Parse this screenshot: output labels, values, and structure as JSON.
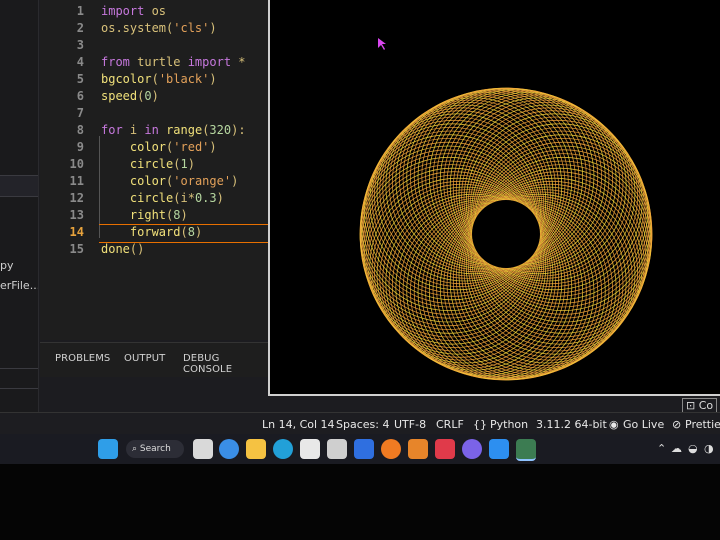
{
  "sidebar": {
    "items": [
      {
        "label": "py"
      },
      {
        "label": "erFile...."
      }
    ]
  },
  "editor": {
    "active_line": 14,
    "lines": [
      {
        "num": "1",
        "tokens": [
          [
            "kw",
            "import"
          ],
          [
            "plain",
            " os"
          ]
        ]
      },
      {
        "num": "2",
        "tokens": [
          [
            "plain",
            "os.system("
          ],
          [
            "str",
            "'cls'"
          ],
          [
            "plain",
            ")"
          ]
        ]
      },
      {
        "num": "3",
        "tokens": []
      },
      {
        "num": "4",
        "tokens": [
          [
            "kw",
            "from"
          ],
          [
            "plain",
            " turtle "
          ],
          [
            "kw",
            "import"
          ],
          [
            "plain",
            " *"
          ]
        ]
      },
      {
        "num": "5",
        "tokens": [
          [
            "fn",
            "bgcolor"
          ],
          [
            "plain",
            "("
          ],
          [
            "str",
            "'black'"
          ],
          [
            "plain",
            ")"
          ]
        ]
      },
      {
        "num": "6",
        "tokens": [
          [
            "fn",
            "speed"
          ],
          [
            "plain",
            "("
          ],
          [
            "num",
            "0"
          ],
          [
            "plain",
            ")"
          ]
        ]
      },
      {
        "num": "7",
        "tokens": []
      },
      {
        "num": "8",
        "tokens": [
          [
            "kw",
            "for"
          ],
          [
            "plain",
            " i "
          ],
          [
            "kw",
            "in"
          ],
          [
            "plain",
            " "
          ],
          [
            "fn",
            "range"
          ],
          [
            "plain",
            "("
          ],
          [
            "num",
            "320"
          ],
          [
            "plain",
            "):"
          ]
        ]
      },
      {
        "num": "9",
        "tokens": [
          [
            "plain",
            "    "
          ],
          [
            "fn",
            "color"
          ],
          [
            "plain",
            "("
          ],
          [
            "str",
            "'red'"
          ],
          [
            "plain",
            ")"
          ]
        ]
      },
      {
        "num": "10",
        "tokens": [
          [
            "plain",
            "    "
          ],
          [
            "fn",
            "circle"
          ],
          [
            "plain",
            "("
          ],
          [
            "num",
            "1"
          ],
          [
            "plain",
            ")"
          ]
        ]
      },
      {
        "num": "11",
        "tokens": [
          [
            "plain",
            "    "
          ],
          [
            "fn",
            "color"
          ],
          [
            "plain",
            "("
          ],
          [
            "str",
            "'orange'"
          ],
          [
            "plain",
            ")"
          ]
        ]
      },
      {
        "num": "12",
        "tokens": [
          [
            "plain",
            "    "
          ],
          [
            "fn",
            "circle"
          ],
          [
            "plain",
            "(i*"
          ],
          [
            "num",
            "0.3"
          ],
          [
            "plain",
            ")"
          ]
        ]
      },
      {
        "num": "13",
        "tokens": [
          [
            "plain",
            "    "
          ],
          [
            "fn",
            "right"
          ],
          [
            "plain",
            "("
          ],
          [
            "num",
            "8"
          ],
          [
            "plain",
            ")"
          ]
        ]
      },
      {
        "num": "14",
        "tokens": [
          [
            "plain",
            "    "
          ],
          [
            "fn",
            "forward"
          ],
          [
            "plain",
            "("
          ],
          [
            "num",
            "8"
          ],
          [
            "plain",
            ")"
          ]
        ]
      },
      {
        "num": "15",
        "tokens": [
          [
            "fn",
            "done"
          ],
          [
            "plain",
            "()"
          ]
        ]
      }
    ]
  },
  "panel": {
    "tabs": [
      "PROBLEMS",
      "OUTPUT",
      "DEBUG CONSOLE"
    ]
  },
  "terminal_button": "Co",
  "statusbar": {
    "position": "Ln 14, Col 14",
    "spaces": "Spaces: 4",
    "encoding": "UTF-8",
    "eol": "CRLF",
    "language": "Python",
    "interpreter": "3.11.2 64-bit",
    "golive": "Go Live",
    "prettier": "Prettier"
  },
  "taskbar": {
    "search_label": "Search"
  },
  "colors": {
    "spiral_outer": "#f2a53a",
    "spiral_inner": "#f7d23a",
    "accent": "#e76f00"
  }
}
